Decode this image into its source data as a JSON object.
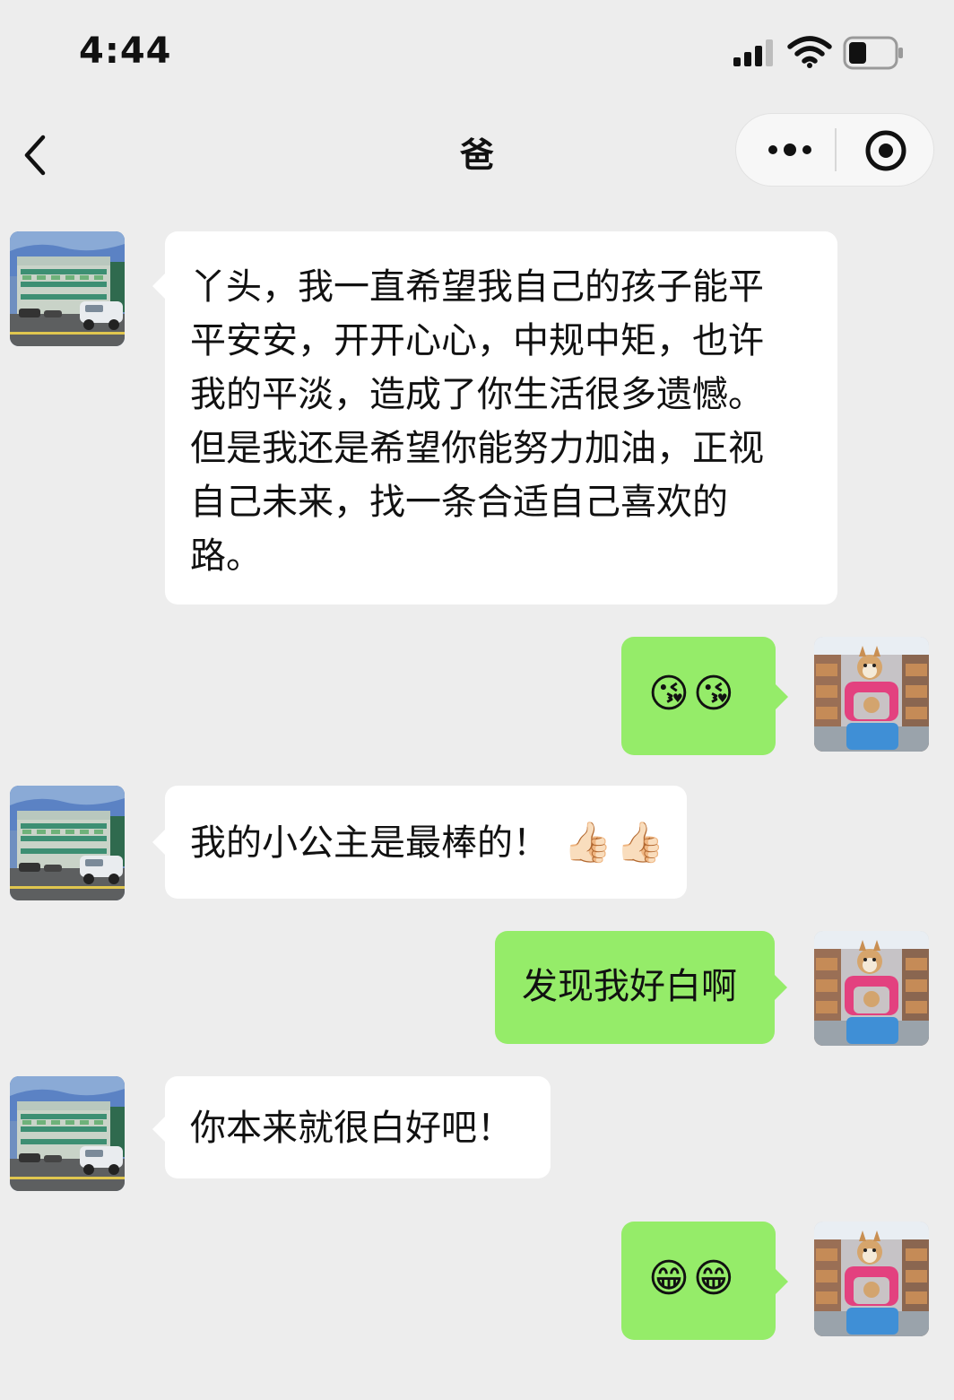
{
  "status_bar": {
    "time": "4:44"
  },
  "header": {
    "title": "爸"
  },
  "messages": [
    {
      "side": "left",
      "lines": [
        "丫头，我一直希望我自己的孩子能平",
        "平安安，开开心心，中规中矩，也许",
        "我的平淡，造成了你生活很多遗憾。",
        "但是我还是希望你能努力加油，正视",
        "自己未来，找一条合适自己喜欢的",
        "路。"
      ]
    },
    {
      "side": "right",
      "emoji": "😘😘"
    },
    {
      "side": "left",
      "text": "我的小公主是最棒的！",
      "emoji": "👍🏻👍🏻"
    },
    {
      "side": "right",
      "text": "发现我好白啊"
    },
    {
      "side": "left",
      "text": "你本来就很白好吧！"
    },
    {
      "side": "right",
      "emoji": "😁😁"
    }
  ],
  "colors": {
    "background": "#ededed",
    "incoming_bubble": "#ffffff",
    "outgoing_bubble": "#95ec69"
  },
  "icons": {
    "back": "chevron-left-icon",
    "more": "more-dots-icon",
    "close": "target-circle-icon",
    "signal": "signal-icon",
    "wifi": "wifi-icon",
    "battery": "battery-icon"
  }
}
